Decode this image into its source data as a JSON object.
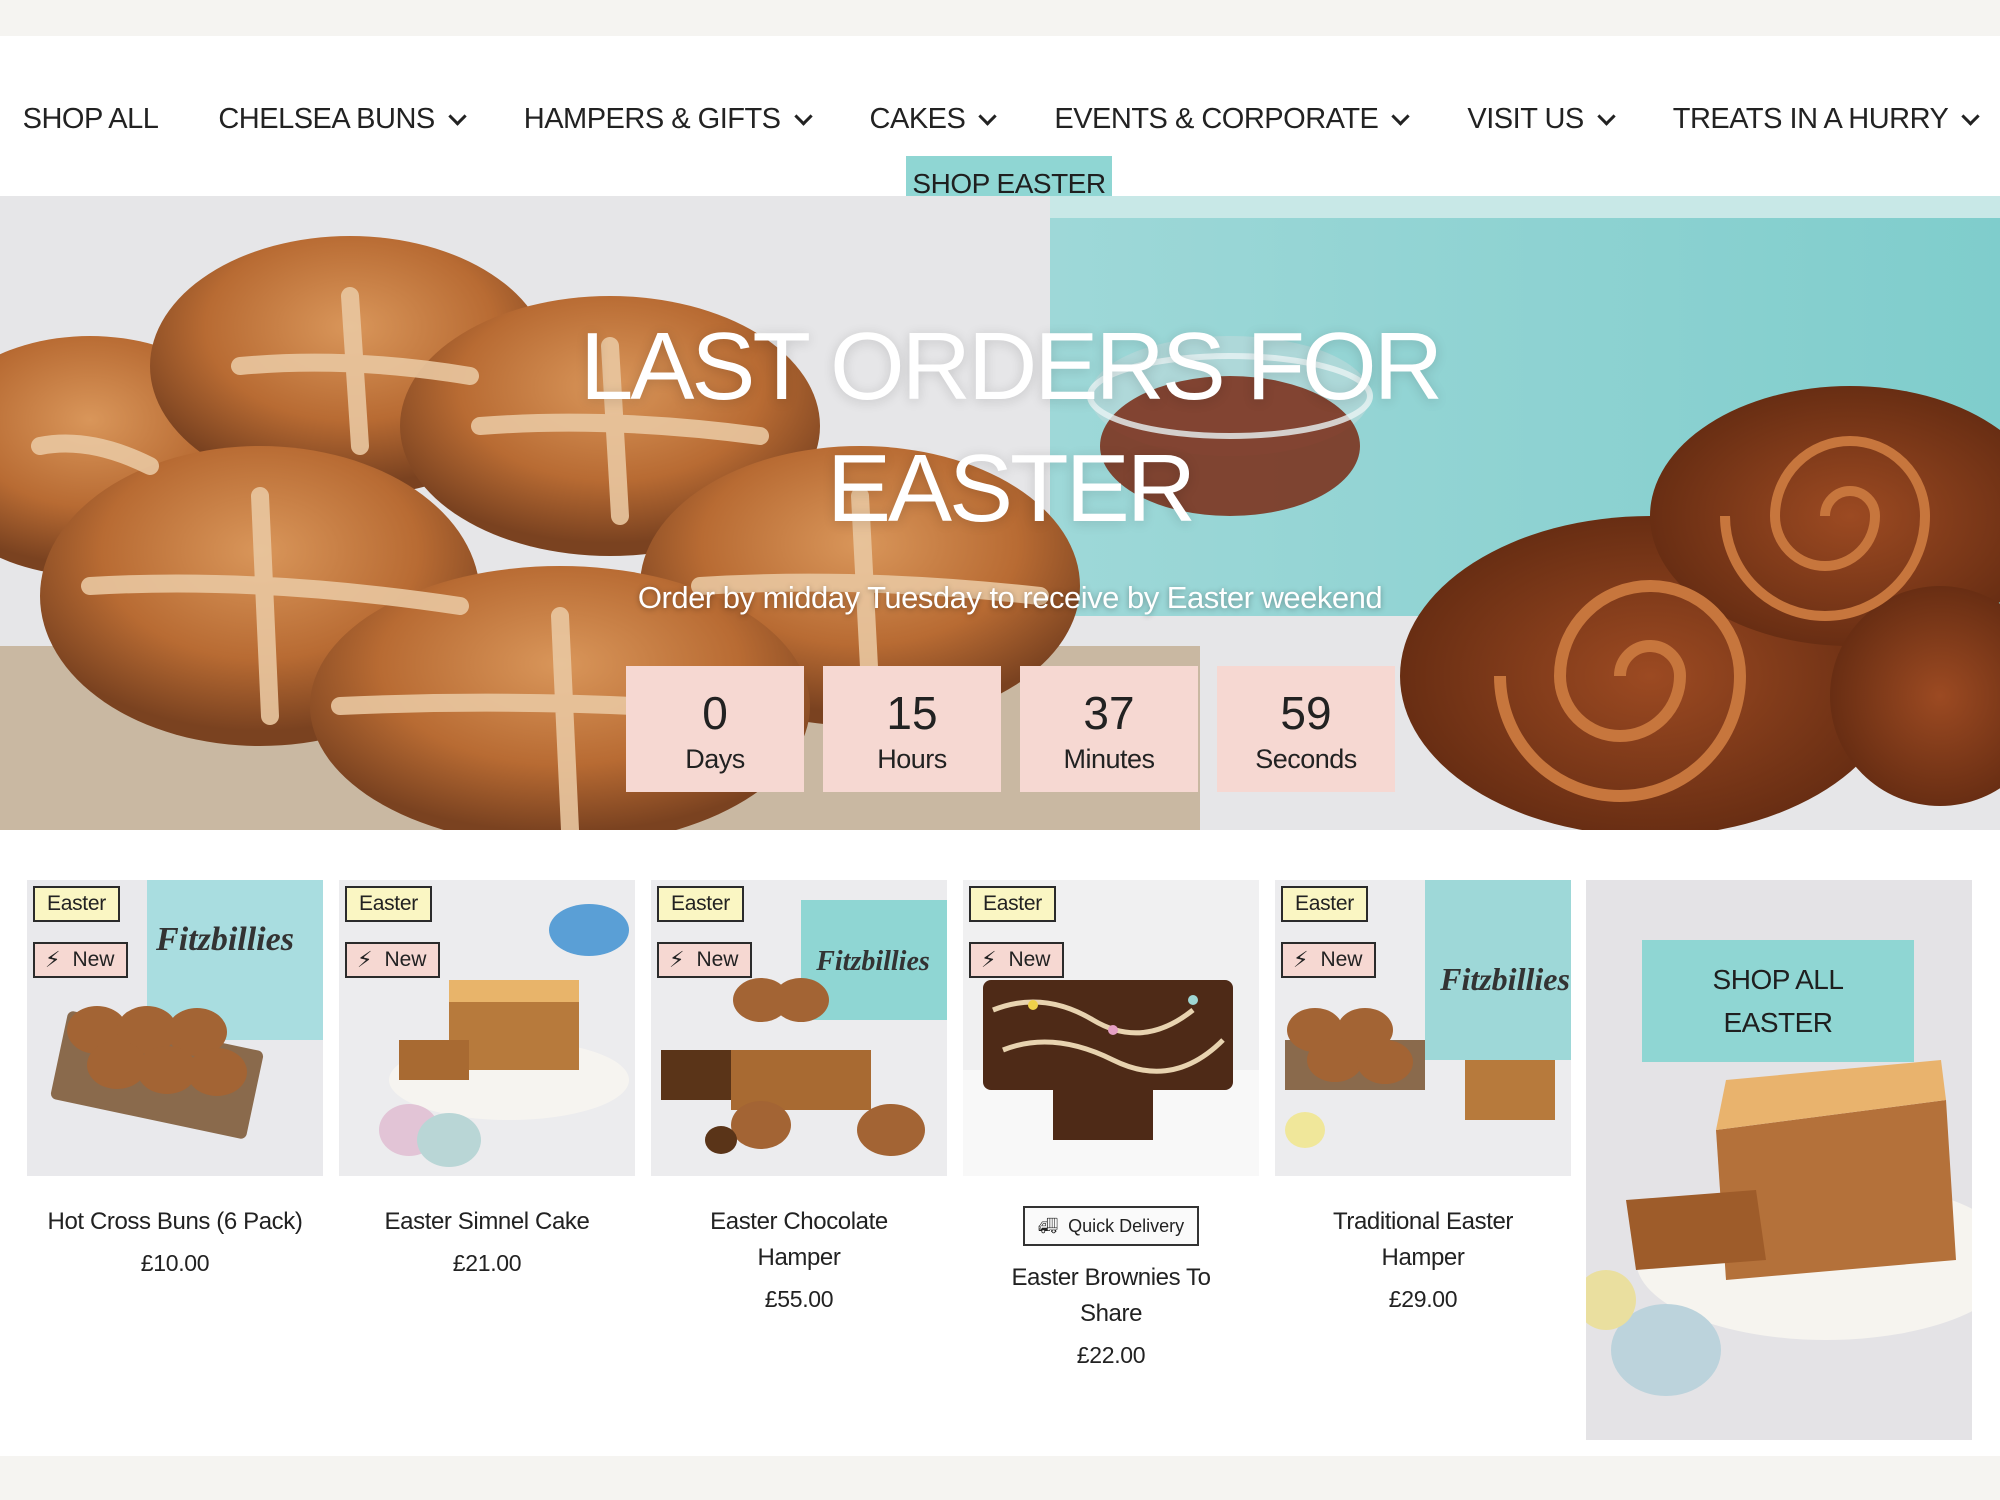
{
  "nav": {
    "items": [
      {
        "label": "SHOP ALL",
        "has_dropdown": false
      },
      {
        "label": "CHELSEA BUNS",
        "has_dropdown": true
      },
      {
        "label": "HAMPERS & GIFTS",
        "has_dropdown": true
      },
      {
        "label": "CAKES",
        "has_dropdown": true
      },
      {
        "label": "EVENTS & CORPORATE",
        "has_dropdown": true
      },
      {
        "label": "VISIT US",
        "has_dropdown": true
      },
      {
        "label": "TREATS IN A HURRY",
        "has_dropdown": true
      }
    ],
    "highlight_label": "SHOP EASTER",
    "highlight_color": "#8fd6d3",
    "dropdown_icon": "chevron-down-icon"
  },
  "hero": {
    "title": "LAST ORDERS FOR EASTER",
    "subtitle": "Order by midday Tuesday to receive by Easter weekend",
    "countdown": [
      {
        "value": "0",
        "unit": "Days"
      },
      {
        "value": "15",
        "unit": "Hours"
      },
      {
        "value": "37",
        "unit": "Minutes"
      },
      {
        "value": "59",
        "unit": "Seconds"
      }
    ],
    "countdown_color": "#f6d8d2"
  },
  "products": [
    {
      "name": "Hot Cross Buns (6 Pack)",
      "price": "£10.00",
      "tags": [
        "Easter",
        "New"
      ],
      "quick_delivery": null
    },
    {
      "name": "Easter Simnel Cake",
      "price": "£21.00",
      "tags": [
        "Easter",
        "New"
      ],
      "quick_delivery": null
    },
    {
      "name": "Easter Chocolate Hamper",
      "price": "£55.00",
      "tags": [
        "Easter",
        "New"
      ],
      "quick_delivery": null
    },
    {
      "name": "Easter Brownies To Share",
      "price": "£22.00",
      "tags": [
        "Easter",
        "New"
      ],
      "quick_delivery": "Quick Delivery"
    },
    {
      "name": "Traditional Easter Hamper",
      "price": "£29.00",
      "tags": [
        "Easter",
        "New"
      ],
      "quick_delivery": null
    }
  ],
  "product_image_labels": {
    "brand_box": "Fitzbillies"
  },
  "promo": {
    "label": "SHOP ALL EASTER",
    "color": "#8fd6d3"
  },
  "colors": {
    "tag_easter": "#faf6c3",
    "tag_new": "#f6d8d2",
    "accent": "#8fd6d3"
  }
}
